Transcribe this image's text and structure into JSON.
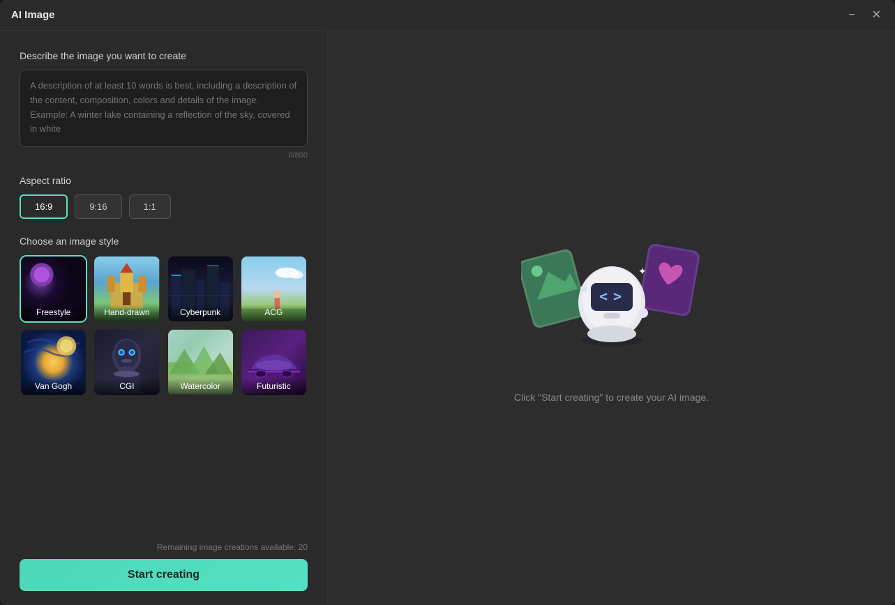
{
  "window": {
    "title": "AI Image",
    "minimize_label": "−",
    "close_label": "✕"
  },
  "left": {
    "describe_label": "Describe the image you want to create",
    "textarea_placeholder": "A description of at least 10 words is best, including a description of the content, composition, colors and details of the image. Example: A winter lake containing a reflection of the sky, covered in white",
    "char_count": "0/800",
    "aspect_label": "Aspect ratio",
    "aspect_options": [
      {
        "id": "16:9",
        "label": "16:9",
        "active": true
      },
      {
        "id": "9:16",
        "label": "9:16",
        "active": false
      },
      {
        "id": "1:1",
        "label": "1:1",
        "active": false
      }
    ],
    "style_label": "Choose an image style",
    "styles": [
      {
        "id": "freestyle",
        "label": "Freestyle",
        "selected": true
      },
      {
        "id": "hand-drawn",
        "label": "Hand-drawn",
        "selected": false
      },
      {
        "id": "cyberpunk",
        "label": "Cyberpunk",
        "selected": false
      },
      {
        "id": "acg",
        "label": "ACG",
        "selected": false
      },
      {
        "id": "vangogh",
        "label": "Van Gogh",
        "selected": false
      },
      {
        "id": "cgi",
        "label": "CGI",
        "selected": false
      },
      {
        "id": "watercolor",
        "label": "Watercolor",
        "selected": false
      },
      {
        "id": "futuristic",
        "label": "Futuristic",
        "selected": false
      }
    ],
    "remaining_text": "Remaining image creations available: 20",
    "start_btn_label": "Start creating"
  },
  "right": {
    "hint_text": "Click \"Start creating\" to create your AI image."
  }
}
